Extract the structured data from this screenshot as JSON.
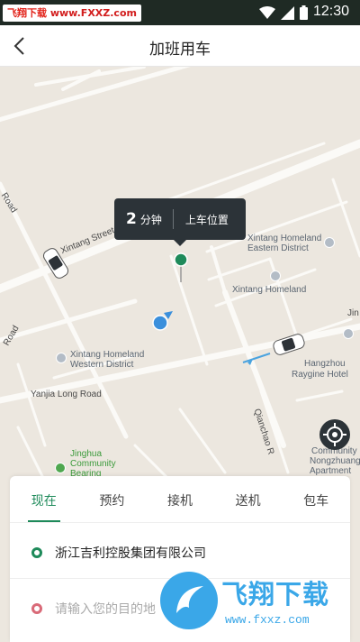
{
  "status_bar": {
    "watermark_prefix": "飞翔下载",
    "watermark_url": "www.FXXZ.com",
    "time": "12:30",
    "icons": [
      "wifi-icon",
      "signal-icon",
      "battery-icon"
    ]
  },
  "header": {
    "title": "加班用车",
    "back_icon": "chevron-left-icon"
  },
  "map": {
    "labels": {
      "xintang_street": "Xintang Street",
      "road_tl": "Road",
      "road_l": "Road",
      "homeland_east_1": "Xintang Homeland",
      "homeland_east_2": "Eastern District",
      "homeland": "Xintang Homeland",
      "homeland_west_1": "Xintang Homeland",
      "homeland_west_2": "Western District",
      "yanjia": "Yanjia Long Road",
      "jin": "Jin",
      "hangzhou": "Hangzhou",
      "raygine": "Raygine Hotel",
      "qianchao": "Qianchao R",
      "jinghua_1": "Jinghua",
      "jinghua_2": "Community",
      "jinghua_3": "Bearing",
      "nongzhuang_1": "Community",
      "nongzhuang_2": "Nongzhuang",
      "nongzhuang_3": "Apartment"
    },
    "pickup_bubble": {
      "minutes": "2",
      "unit": "分钟",
      "text": "上车位置"
    }
  },
  "booking": {
    "tabs": [
      "现在",
      "预约",
      "接机",
      "送机",
      "包车"
    ],
    "active_tab": "现在",
    "from": "浙江吉利控股集团有限公司",
    "to_placeholder": "请输入您的目的地"
  },
  "watermark": {
    "brand": "飞翔下载",
    "url": "www.fxxz.com"
  },
  "colors": {
    "accent": "#1e8a5a",
    "destination": "#d96a78",
    "bubble": "#2c3338",
    "watermark": "#3aa7e8"
  }
}
